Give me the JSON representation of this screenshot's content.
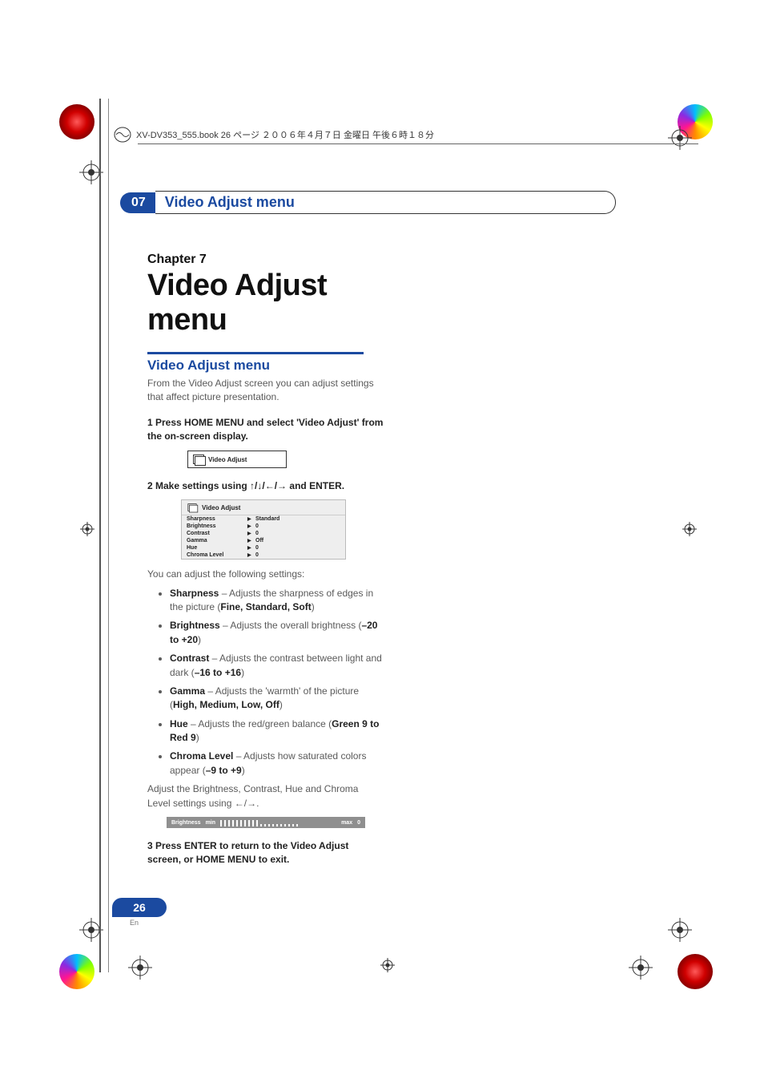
{
  "meta": {
    "bookline": "XV-DV353_555.book 26 ページ ２００６年４月７日 金曜日 午後６時１８分"
  },
  "header": {
    "num": "07",
    "title": "Video Adjust menu"
  },
  "chapter": {
    "label": "Chapter 7",
    "title": "Video Adjust menu"
  },
  "section": {
    "title": "Video Adjust menu",
    "intro": "From the Video Adjust screen you can adjust settings that affect picture presentation."
  },
  "steps": {
    "s1": "1    Press HOME MENU and select 'Video Adjust' from the on-screen display.",
    "s2_pre": "2    Make settings using ",
    "s2_post": " and ENTER.",
    "s3": "3    Press ENTER to return to the Video Adjust screen, or HOME MENU to exit."
  },
  "menubox": {
    "label": "Video Adjust"
  },
  "osd": {
    "title": "Video Adjust",
    "rows": [
      {
        "label": "Sharpness",
        "value": "Standard"
      },
      {
        "label": "Brightness",
        "value": "0"
      },
      {
        "label": "Contrast",
        "value": "0"
      },
      {
        "label": "Gamma",
        "value": "Off"
      },
      {
        "label": "Hue",
        "value": "0"
      },
      {
        "label": "Chroma Level",
        "value": "0"
      }
    ]
  },
  "settings_intro": "You can adjust the following settings:",
  "settings": {
    "sharpness": {
      "name": "Sharpness",
      "desc": " – Adjusts the sharpness of edges in the picture (",
      "opts": "Fine, Standard, Soft",
      "close": ")"
    },
    "brightness": {
      "name": "Brightness",
      "desc": " – Adjusts the overall brightness (",
      "opts": "–20 to +20",
      "close": ")"
    },
    "contrast": {
      "name": "Contrast",
      "desc": " – Adjusts the contrast between light and dark (",
      "opts": "–16 to +16",
      "close": ")"
    },
    "gamma": {
      "name": "Gamma",
      "desc": " – Adjusts the 'warmth' of the picture (",
      "opts": "High, Medium, Low, Off",
      "close": ")"
    },
    "hue": {
      "name": "Hue",
      "desc": " – Adjusts the red/green balance (",
      "opts": "Green 9 to Red 9",
      "close": ")"
    },
    "chroma": {
      "name": "Chroma Level",
      "desc": " – Adjusts how saturated colors appear (",
      "opts": "–9 to +9",
      "close": ")"
    }
  },
  "adjust_line_pre": "Adjust the Brightness, Contrast, Hue and Chroma Level settings using ",
  "adjust_line_post": ".",
  "slider": {
    "label": "Brightness",
    "min": "min",
    "max": "max",
    "value": "0"
  },
  "page": {
    "num": "26",
    "lang": "En"
  },
  "arrows": {
    "updownleftright": "↑/↓/←/→",
    "leftright": "←/→"
  }
}
